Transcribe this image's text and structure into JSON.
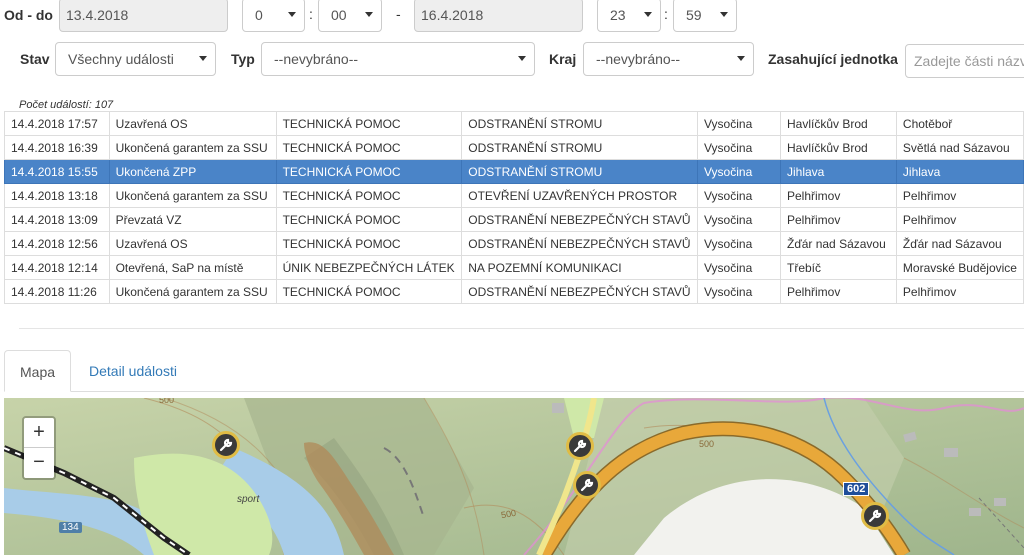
{
  "filters": {
    "od_do_label": "Od - do",
    "date_from": "13.4.2018",
    "hour_from": "0",
    "minute_from": "00",
    "separator_colon": ":",
    "range_dash": "-",
    "date_to": "16.4.2018",
    "hour_to": "23",
    "minute_to": "59",
    "stav_label": "Stav",
    "stav_value": "Všechny události",
    "typ_label": "Typ",
    "typ_value": "--nevybráno--",
    "kraj_label": "Kraj",
    "kraj_value": "--nevybráno--",
    "jednotka_label": "Zasahující jednotka",
    "jednotka_placeholder": "Zadejte části názvu"
  },
  "count_text": "Počet událostí: 107",
  "events": [
    {
      "time": "14.4.2018 17:57",
      "status": "Uzavřená OS",
      "type": "TECHNICKÁ POMOC",
      "subtype": "ODSTRANĚNÍ STROMU",
      "region": "Vysočina",
      "district": "Havlíčkův Brod",
      "place": "Chotěboř"
    },
    {
      "time": "14.4.2018 16:39",
      "status": "Ukončená garantem za SSU",
      "type": "TECHNICKÁ POMOC",
      "subtype": "ODSTRANĚNÍ STROMU",
      "region": "Vysočina",
      "district": "Havlíčkův Brod",
      "place": "Světlá nad Sázavou"
    },
    {
      "time": "14.4.2018 15:55",
      "status": "Ukončená ZPP",
      "type": "TECHNICKÁ POMOC",
      "subtype": "ODSTRANĚNÍ STROMU",
      "region": "Vysočina",
      "district": "Jihlava",
      "place": "Jihlava"
    },
    {
      "time": "14.4.2018 13:18",
      "status": "Ukončená garantem za SSU",
      "type": "TECHNICKÁ POMOC",
      "subtype": "OTEVŘENÍ UZAVŘENÝCH PROSTOR",
      "region": "Vysočina",
      "district": "Pelhřimov",
      "place": "Pelhřimov"
    },
    {
      "time": "14.4.2018 13:09",
      "status": "Převzatá VZ",
      "type": "TECHNICKÁ POMOC",
      "subtype": "ODSTRANĚNÍ NEBEZPEČNÝCH STAVŮ",
      "region": "Vysočina",
      "district": "Pelhřimov",
      "place": "Pelhřimov"
    },
    {
      "time": "14.4.2018 12:56",
      "status": "Uzavřená OS",
      "type": "TECHNICKÁ POMOC",
      "subtype": "ODSTRANĚNÍ NEBEZPEČNÝCH STAVŮ",
      "region": "Vysočina",
      "district": "Žďár nad Sázavou",
      "place": "Žďár nad Sázavou"
    },
    {
      "time": "14.4.2018 12:14",
      "status": "Otevřená, SaP na místě",
      "type": "ÚNIK NEBEZPEČNÝCH LÁTEK",
      "subtype": "NA POZEMNÍ KOMUNIKACI",
      "region": "Vysočina",
      "district": "Třebíč",
      "place": "Moravské Budějovice"
    },
    {
      "time": "14.4.2018 11:26",
      "status": "Ukončená garantem za SSU",
      "type": "TECHNICKÁ POMOC",
      "subtype": "ODSTRANĚNÍ NEBEZPEČNÝCH STAVŮ",
      "region": "Vysočina",
      "district": "Pelhřimov",
      "place": "Pelhřimov"
    }
  ],
  "selected_index": 2,
  "tabs": [
    {
      "label": "Mapa",
      "active": true
    },
    {
      "label": "Detail události",
      "active": false
    }
  ],
  "map": {
    "zoom_in": "+",
    "zoom_out": "−",
    "labels": {
      "contour_500_a": "500",
      "contour_500_b": "500",
      "contour_500_c": "500",
      "sport": "sport",
      "road_134": "134",
      "road_602": "602"
    },
    "markers": [
      "wrench-marker",
      "wrench-marker",
      "wrench-marker",
      "wrench-marker"
    ]
  },
  "colors": {
    "selected_row": "#4a84c8",
    "link": "#337ab7",
    "road": "#e8a83a",
    "river": "#a8cce8",
    "marker_ring": "#e0bc45"
  }
}
